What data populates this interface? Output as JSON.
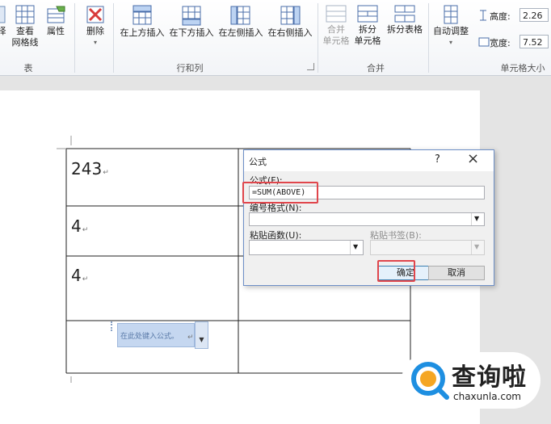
{
  "ribbon": {
    "btn_view_gridlines": "查看\n网格线",
    "btn_properties": "属性",
    "btn_delete": "删除",
    "btn_insert_above": "在上方插入",
    "btn_insert_below": "在下方插入",
    "btn_insert_left": "在左侧插入",
    "btn_insert_right": "在右侧插入",
    "btn_merge_cells": "合并\n单元格",
    "btn_split_cells": "拆分\n单元格",
    "btn_split_table": "拆分表格",
    "btn_autofit": "自动调整",
    "height_label": "高度:",
    "height_value": "2.26",
    "width_label": "宽度:",
    "width_value": "7.52",
    "group_table": "表",
    "group_rows_cols": "行和列",
    "group_merge": "合并",
    "group_cell_size": "单元格大小"
  },
  "table": {
    "cells": [
      "243",
      "4",
      "4"
    ],
    "placeholder_hint": "在此处键入公式。"
  },
  "dialog": {
    "title": "公式",
    "help": "?",
    "close": "×",
    "formula_label": "公式(F):",
    "formula_value": "=SUM(ABOVE)",
    "number_format_label": "编号格式(N):",
    "paste_function_label": "粘贴函数(U):",
    "paste_bookmark_label": "粘贴书签(B):",
    "ok": "确定",
    "cancel": "取消"
  },
  "watermark": {
    "brand_cn": "查询啦",
    "brand_url": "chaxunla.com"
  },
  "colors": {
    "highlight_red": "#e0464c",
    "ribbon_bg": "#f2f4f7",
    "dialog_bg": "#f0f0f0",
    "brand_blue": "#1e8fe1",
    "brand_orange": "#f5a623"
  }
}
